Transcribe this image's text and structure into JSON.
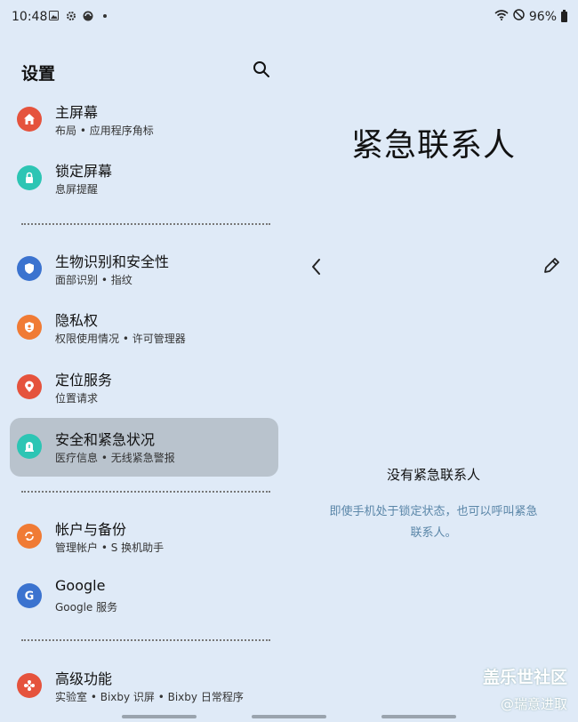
{
  "status_bar": {
    "time": "10:48",
    "battery": "96%"
  },
  "settings": {
    "title": "设置",
    "items": [
      {
        "title": "主屏幕",
        "subtitle": "布局 • 应用程序角标",
        "color": "#e5533d",
        "icon": "home-icon"
      },
      {
        "title": "锁定屏幕",
        "subtitle": "息屏提醒",
        "color": "#2dc5b4",
        "icon": "lock-icon"
      },
      {
        "title": "生物识别和安全性",
        "subtitle": "面部识别 • 指纹",
        "color": "#3b73cf",
        "icon": "shield-icon"
      },
      {
        "title": "隐私权",
        "subtitle": "权限使用情况 • 许可管理器",
        "color": "#f07b35",
        "icon": "privacy-icon"
      },
      {
        "title": "定位服务",
        "subtitle": "位置请求",
        "color": "#e5533d",
        "icon": "location-icon"
      },
      {
        "title": "安全和紧急状况",
        "subtitle": "医疗信息 • 无线紧急警报",
        "color": "#2dc5b4",
        "icon": "emergency-icon"
      },
      {
        "title": "帐户与备份",
        "subtitle": "管理帐户 • S 换机助手",
        "color": "#f07b35",
        "icon": "sync-icon"
      },
      {
        "title": "Google",
        "subtitle": "Google 服务",
        "color": "#3b73cf",
        "icon": "google-icon"
      },
      {
        "title": "高级功能",
        "subtitle": "实验室 • Bixby 识屏 • Bixby 日常程序",
        "color": "#e5533d",
        "icon": "advanced-icon"
      }
    ]
  },
  "detail": {
    "title": "紧急联系人",
    "empty_title": "没有紧急联系人",
    "empty_desc": "即使手机处于锁定状态，也可以呼叫紧急联系人。"
  },
  "watermark": {
    "line1": "盖乐世社区",
    "line2": "@瑞意进取"
  }
}
